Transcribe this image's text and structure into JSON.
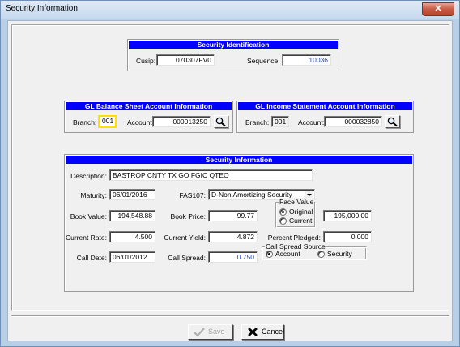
{
  "window": {
    "title": "Security Information",
    "close_glyph": "✕"
  },
  "security_identification": {
    "header": "Security Identification",
    "cusip_label": "Cusip:",
    "cusip_value": "070307FV0",
    "sequence_label": "Sequence:",
    "sequence_value": "10036"
  },
  "gl_balance_sheet": {
    "header": "GL Balance Sheet Account Information",
    "branch_label": "Branch:",
    "branch_value": "001",
    "account_label": "Account:",
    "account_value": "000013250",
    "search_icon": "magnifier-icon"
  },
  "gl_income_statement": {
    "header": "GL Income Statement Account Information",
    "branch_label": "Branch:",
    "branch_value": "001",
    "account_label": "Account:",
    "account_value": "000032850",
    "search_icon": "magnifier-icon"
  },
  "security_information": {
    "header": "Security Information",
    "description_label": "Description:",
    "description_value": "BASTROP CNTY TX GO FGIC QTEO",
    "maturity_label": "Maturity:",
    "maturity_value": "06/01/2016",
    "fas107_label": "FAS107:",
    "fas107_value": "D-Non Amortizing Security",
    "book_value_label": "Book Value:",
    "book_value_value": "194,548.88",
    "book_price_label": "Book Price:",
    "book_price_value": "99.77",
    "face_value_legend": "Face Value",
    "face_value_options": [
      "Original",
      "Current"
    ],
    "face_value_selected": "Original",
    "face_value_value": "195,000.00",
    "current_rate_label": "Current Rate:",
    "current_rate_value": "4.500",
    "current_yield_label": "Current Yield:",
    "current_yield_value": "4.872",
    "percent_pledged_label": "Percent Pledged:",
    "percent_pledged_value": "0.000",
    "call_date_label": "Call Date:",
    "call_date_value": "06/01/2012",
    "call_spread_label": "Call Spread:",
    "call_spread_value": "0.750",
    "call_spread_source_legend": "Call Spread Source",
    "call_spread_source_options": [
      "Account",
      "Security"
    ],
    "call_spread_source_selected": "Account"
  },
  "buttons": {
    "save_label": "Save",
    "cancel_label": "Cancel"
  },
  "colors": {
    "header_blue": "#0000ff",
    "value_blue": "#1a3fbf",
    "focus_yellow": "#ffe000"
  }
}
